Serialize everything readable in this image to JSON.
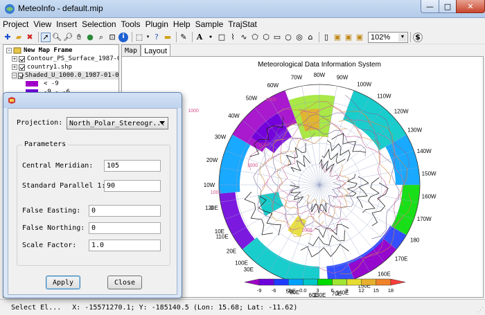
{
  "window": {
    "title": "MeteoInfo - default.mip",
    "controls": {
      "minimize": "—",
      "maximize": "□",
      "close": "✕"
    }
  },
  "menu": [
    "Project",
    "View",
    "Insert",
    "Selection",
    "Tools",
    "Plugin",
    "Help",
    "Sample",
    "TrajStat"
  ],
  "toolbar": {
    "icons": [
      "add-layer-icon",
      "open-folder-icon",
      "remove-icon",
      "select-arrow-icon",
      "zoom-in-icon",
      "zoom-out-icon",
      "pan-hand-icon",
      "globe-icon",
      "full-extent-icon",
      "zoom-layer-icon",
      "identify-icon",
      "select-features-icon",
      "measure-icon",
      "label-icon",
      "edit-icon",
      "text-icon",
      "point-icon",
      "rectangle-icon",
      "polyline-icon",
      "curve-icon",
      "polygon-icon",
      "curve-polygon-icon",
      "freehand-icon",
      "circle-icon",
      "ellipse-icon",
      "page-icon",
      "page-zoom-in-icon",
      "page-zoom-out-icon",
      "page-fit-icon",
      "money-icon"
    ],
    "zoom_value": "102%"
  },
  "legend": {
    "frame": "New Map Frame",
    "layers": [
      "Contour_PS_Surface_1987-01-",
      "country1.shp",
      "Shaded_U_1000.0_1987-01-01"
    ],
    "first_break": "< -9",
    "second_break": "-9 - -6",
    "break_colors": [
      "#a000c8",
      "#6e00dc"
    ]
  },
  "tabs": {
    "map": "Map",
    "layout": "Layout"
  },
  "map": {
    "title": "Meteorological Data Information System",
    "lon_labels": [
      "60W",
      "70W",
      "80W",
      "90W",
      "100W",
      "110W",
      "50W",
      "40W",
      "120W",
      "30W",
      "130W",
      "20W",
      "140W",
      "10W",
      "150W",
      "0",
      "160W",
      "10E",
      "170W",
      "20E",
      "180",
      "30E",
      "170E",
      "40E",
      "160E",
      "50E",
      "150E",
      "60E",
      "140E",
      "70E",
      "130E",
      "80E",
      "90E",
      "100E",
      "110E",
      "120E"
    ],
    "contour_labels": [
      "1000",
      "1000",
      "1000",
      "1000",
      "950",
      "950",
      "1000",
      "1000"
    ],
    "colorbar_labels": [
      "-9",
      "-6",
      "-3",
      "0.0",
      "3",
      "6",
      "9",
      "12",
      "15",
      "18"
    ],
    "colorbar_colors": [
      "#a000c8",
      "#6e00dc",
      "#1e3cff",
      "#00a0ff",
      "#00c8c8",
      "#00dc00",
      "#a0e632",
      "#e6dc32",
      "#e6af2d",
      "#f08228",
      "#fa3c3c"
    ]
  },
  "status": {
    "tool": "Select El...",
    "coords": "X: -15571270.1; Y: -185140.5 (Lon: 15.68; Lat: -11.62)"
  },
  "dialog": {
    "projection_label": "Projection:",
    "projection_value": "North_Polar_Stereogr...",
    "parameters_label": "Parameters",
    "central_meridian_label": "Central Meridian:",
    "central_meridian_value": "105",
    "std_parallel_label": "Standard Parallel 1:",
    "std_parallel_value": "90",
    "false_easting_label": "False Easting:",
    "false_easting_value": "0",
    "false_northing_label": "False Northing:",
    "false_northing_value": "0",
    "scale_factor_label": "Scale Factor:",
    "scale_factor_value": "1.0",
    "apply_label": "Apply",
    "close_label": "Close"
  }
}
